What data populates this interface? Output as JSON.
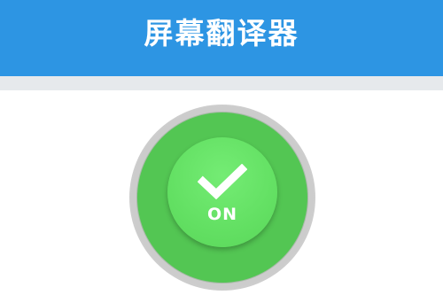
{
  "header": {
    "title": "屏幕翻译器"
  },
  "toggle": {
    "state_label": "ON",
    "icon": "checkmark-icon"
  },
  "colors": {
    "header_bg": "#2d95e3",
    "toggle_green": "#53c653",
    "button_green": "#63e063"
  }
}
